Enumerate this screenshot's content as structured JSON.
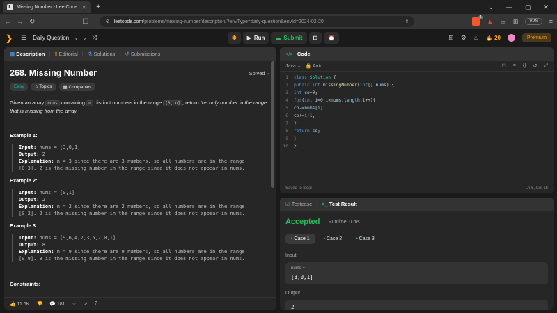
{
  "browser": {
    "tab_title": "Missing Number - LeetCode",
    "url_domain": "leetcode.com",
    "url_path": "/problems/missing-number/description/?envType=daily-question&envId=2024-02-20",
    "vpn": "VPN",
    "brave_badge": "4"
  },
  "header": {
    "daily": "Daily Question",
    "run": "Run",
    "submit": "Submit",
    "streak": "20",
    "premium": "Premium"
  },
  "desc_tabs": [
    "Description",
    "Editorial",
    "Solutions",
    "Submissions"
  ],
  "problem": {
    "title": "268. Missing Number",
    "solved": "Solved",
    "difficulty": "Easy",
    "topics": "Topics",
    "companies": "Companies",
    "s1": "Given an array ",
    "s_nums": "nums",
    "s2": " containing ",
    "s_n": "n",
    "s3": " distinct numbers in the range ",
    "s_range": "[0, n]",
    "s4": ", return ",
    "s_em": "the only number in the range that is missing from the array."
  },
  "examples": [
    {
      "title": "Example 1:",
      "input": "nums = [3,0,1]",
      "output": "2",
      "expl1": "n = 3 since there are 3 numbers, so all numbers are in the range",
      "expl2": "[0,3]. 2 is the missing number in the range since it does not appear in nums."
    },
    {
      "title": "Example 2:",
      "input": "nums = [0,1]",
      "output": "2",
      "expl1": "n = 2 since there are 2 numbers, so all numbers are in the range",
      "expl2": "[0,2]. 2 is the missing number in the range since it does not appear in nums."
    },
    {
      "title": "Example 3:",
      "input": "nums = [9,6,4,2,3,5,7,0,1]",
      "output": "8",
      "expl1": "n = 9 since there are 9 numbers, so all numbers are in the range",
      "expl2": "[0,9]. 8 is the missing number in the range since it does not appear in nums."
    }
  ],
  "labels": {
    "input": "Input:",
    "output": "Output:",
    "explanation": "Explanation:",
    "constraints": "Constraints:"
  },
  "footer": {
    "likes": "11.6K",
    "comments": "181"
  },
  "editor": {
    "title": "Code",
    "lang": "Java",
    "auto": "Auto",
    "saved": "Saved to local",
    "pos": "Ln 6, Col 16"
  },
  "result": {
    "tab1": "Testcase",
    "tab2": "Test Result",
    "status": "Accepted",
    "runtime": "Runtime: 0 ms",
    "cases": [
      "Case 1",
      "Case 2",
      "Case 3"
    ],
    "input_label": "Input",
    "input_var": "nums =",
    "input_val": "[3,0,1]",
    "output_label": "Output",
    "output_val": "2"
  }
}
